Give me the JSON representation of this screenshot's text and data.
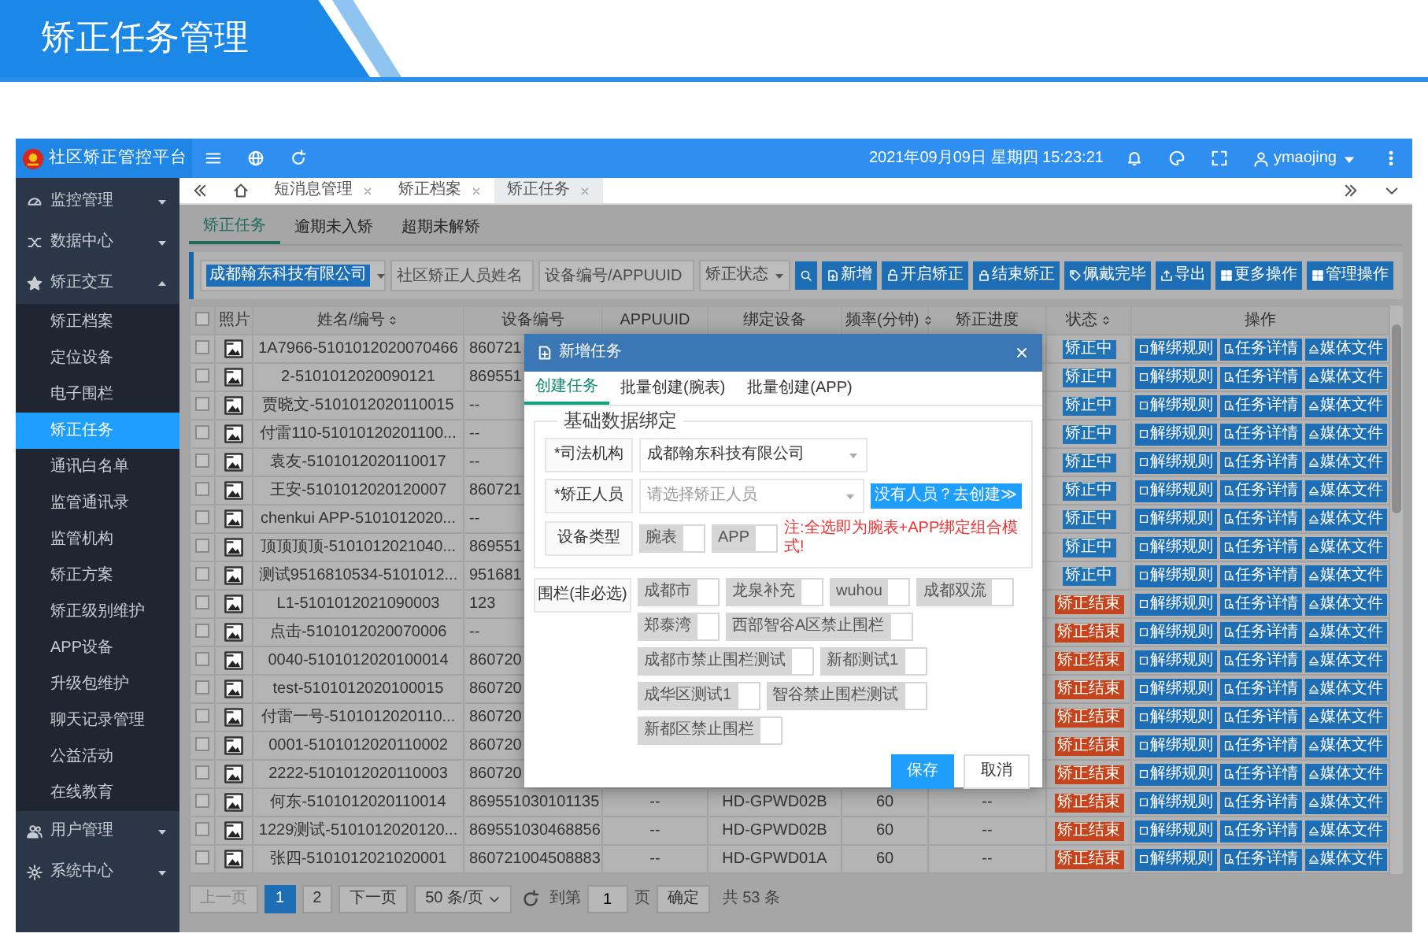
{
  "banner": {
    "title": "矫正任务管理"
  },
  "app": {
    "name": "社区矫正管控平台"
  },
  "header": {
    "datetime": "2021年09月09日 星期四 15:23:21",
    "user": "ymaojing"
  },
  "sidebar": {
    "items": [
      {
        "label": "监控管理",
        "expanded": false
      },
      {
        "label": "数据中心",
        "expanded": false
      },
      {
        "label": "矫正交互",
        "expanded": true,
        "children": [
          {
            "label": "矫正档案",
            "selected": false
          },
          {
            "label": "定位设备",
            "selected": false
          },
          {
            "label": "电子围栏",
            "selected": false
          },
          {
            "label": "矫正任务",
            "selected": true
          },
          {
            "label": "通讯白名单",
            "selected": false
          },
          {
            "label": "监管通讯录",
            "selected": false
          },
          {
            "label": "监管机构",
            "selected": false
          },
          {
            "label": "矫正方案",
            "selected": false
          },
          {
            "label": "矫正级别维护",
            "selected": false
          },
          {
            "label": "APP设备",
            "selected": false
          },
          {
            "label": "升级包维护",
            "selected": false
          },
          {
            "label": "聊天记录管理",
            "selected": false
          },
          {
            "label": "公益活动",
            "selected": false
          },
          {
            "label": "在线教育",
            "selected": false
          }
        ]
      },
      {
        "label": "用户管理",
        "expanded": false
      },
      {
        "label": "系统中心",
        "expanded": false
      }
    ]
  },
  "page_tabs": [
    {
      "label": "短消息管理",
      "selected": false
    },
    {
      "label": "矫正档案",
      "selected": false
    },
    {
      "label": "矫正任务",
      "selected": true
    }
  ],
  "sub_tabs": [
    {
      "label": "矫正任务",
      "selected": true
    },
    {
      "label": "逾期未入矫",
      "selected": false
    },
    {
      "label": "超期未解矫",
      "selected": false
    }
  ],
  "filters": {
    "org": "成都翰东科技有限公司",
    "name_placeholder": "社区矫正人员姓名",
    "device_placeholder": "设备编号/APPUUID",
    "status_placeholder": "矫正状态"
  },
  "toolbar": [
    {
      "kind": "search"
    },
    {
      "kind": "add",
      "label": "新增"
    },
    {
      "kind": "start",
      "label": "开启矫正"
    },
    {
      "kind": "stop",
      "label": "结束矫正"
    },
    {
      "kind": "wear",
      "label": "佩戴完毕"
    },
    {
      "kind": "export",
      "label": "导出"
    },
    {
      "kind": "more",
      "label": "更多操作"
    },
    {
      "kind": "manage",
      "label": "管理操作"
    }
  ],
  "table": {
    "select_all": {
      "checked": false
    },
    "columns": [
      {
        "label": "照片",
        "sortable": false
      },
      {
        "label": "姓名/编号",
        "sortable": true
      },
      {
        "label": "设备编号",
        "sortable": false
      },
      {
        "label": "APPUUID",
        "sortable": false
      },
      {
        "label": "绑定设备",
        "sortable": false
      },
      {
        "label": "频率(分钟)",
        "sortable": true
      },
      {
        "label": "矫正进度",
        "sortable": false
      },
      {
        "label": "状态",
        "sortable": true
      },
      {
        "label": "操作",
        "sortable": false
      }
    ],
    "rows": [
      {
        "checked": false,
        "name": "1A7966-5101012020070466",
        "device": "860721",
        "status": {
          "label": "矫正中",
          "color": "#2173b5"
        },
        "actions": [
          "解绑规则",
          "任务详情",
          "媒体文件"
        ]
      },
      {
        "checked": false,
        "name": "2-5101012020090121",
        "device": "869551",
        "status": {
          "label": "矫正中",
          "color": "#2173b5"
        },
        "actions": [
          "解绑规则",
          "任务详情",
          "媒体文件"
        ]
      },
      {
        "checked": false,
        "name": "贾晓文-5101012020110015",
        "device": "--",
        "status": {
          "label": "矫正中",
          "color": "#2173b5"
        },
        "actions": [
          "解绑规则",
          "任务详情",
          "媒体文件"
        ]
      },
      {
        "checked": false,
        "name": "付雷110-51010120201100...",
        "device": "--",
        "status": {
          "label": "矫正中",
          "color": "#2173b5"
        },
        "actions": [
          "解绑规则",
          "任务详情",
          "媒体文件"
        ]
      },
      {
        "checked": false,
        "name": "袁友-5101012020110017",
        "device": "--",
        "status": {
          "label": "矫正中",
          "color": "#2173b5"
        },
        "actions": [
          "解绑规则",
          "任务详情",
          "媒体文件"
        ]
      },
      {
        "checked": false,
        "name": "王安-5101012020120007",
        "device": "860721",
        "status": {
          "label": "矫正中",
          "color": "#2173b5"
        },
        "actions": [
          "解绑规则",
          "任务详情",
          "媒体文件"
        ]
      },
      {
        "checked": false,
        "name": "chenkui APP-5101012020...",
        "device": "--",
        "status": {
          "label": "矫正中",
          "color": "#2173b5"
        },
        "actions": [
          "解绑规则",
          "任务详情",
          "媒体文件"
        ]
      },
      {
        "checked": false,
        "name": "顶顶顶顶-5101012021040...",
        "device": "869551",
        "status": {
          "label": "矫正中",
          "color": "#2173b5"
        },
        "actions": [
          "解绑规则",
          "任务详情",
          "媒体文件"
        ]
      },
      {
        "checked": false,
        "name": "测试9516810534-5101012...",
        "device": "951681",
        "status": {
          "label": "矫正中",
          "color": "#2173b5"
        },
        "actions": [
          "解绑规则",
          "任务详情",
          "媒体文件"
        ]
      },
      {
        "checked": false,
        "name": "L1-5101012021090003",
        "device": "123",
        "status": {
          "label": "矫正结束",
          "color": "#c4441e"
        },
        "actions": [
          "解绑规则",
          "任务详情",
          "媒体文件"
        ]
      },
      {
        "checked": false,
        "name": "点击-5101012020070006",
        "device": "--",
        "status": {
          "label": "矫正结束",
          "color": "#c4441e"
        },
        "actions": [
          "解绑规则",
          "任务详情",
          "媒体文件"
        ]
      },
      {
        "checked": false,
        "name": "0040-5101012020100014",
        "device": "860720",
        "status": {
          "label": "矫正结束",
          "color": "#c4441e"
        },
        "actions": [
          "解绑规则",
          "任务详情",
          "媒体文件"
        ]
      },
      {
        "checked": false,
        "name": "test-5101012020100015",
        "device": "860720",
        "status": {
          "label": "矫正结束",
          "color": "#c4441e"
        },
        "actions": [
          "解绑规则",
          "任务详情",
          "媒体文件"
        ]
      },
      {
        "checked": false,
        "name": "付雷一号-5101012020110...",
        "device": "860720",
        "status": {
          "label": "矫正结束",
          "color": "#c4441e"
        },
        "actions": [
          "解绑规则",
          "任务详情",
          "媒体文件"
        ]
      },
      {
        "checked": false,
        "name": "0001-5101012020110002",
        "device": "860720",
        "status": {
          "label": "矫正结束",
          "color": "#c4441e"
        },
        "actions": [
          "解绑规则",
          "任务详情",
          "媒体文件"
        ]
      },
      {
        "checked": false,
        "name": "2222-5101012020110003",
        "device": "860720",
        "status": {
          "label": "矫正结束",
          "color": "#c4441e"
        },
        "actions": [
          "解绑规则",
          "任务详情",
          "媒体文件"
        ]
      },
      {
        "checked": false,
        "name": "何东-5101012020110014",
        "device": "869551030101135",
        "appuuid": "--",
        "bound_device": "HD-GPWD02B",
        "frequency": "60",
        "progress": "--",
        "status": {
          "label": "矫正结束",
          "color": "#c4441e"
        },
        "actions": [
          "解绑规则",
          "任务详情",
          "媒体文件"
        ]
      },
      {
        "checked": false,
        "name": "1229测试-5101012020120...",
        "device": "869551030468856",
        "appuuid": "--",
        "bound_device": "HD-GPWD02B",
        "frequency": "60",
        "progress": "--",
        "status": {
          "label": "矫正结束",
          "color": "#c4441e"
        },
        "actions": [
          "解绑规则",
          "任务详情",
          "媒体文件"
        ]
      },
      {
        "checked": false,
        "name": "张四-5101012021020001",
        "device": "860721004508883",
        "appuuid": "--",
        "bound_device": "HD-GPWD01A",
        "frequency": "60",
        "progress": "--",
        "status": {
          "label": "矫正结束",
          "color": "#c4441e"
        },
        "actions": [
          "解绑规则",
          "任务详情",
          "媒体文件"
        ]
      }
    ]
  },
  "pagination": {
    "prev": {
      "label": "上一页",
      "disabled": true
    },
    "pages": [
      {
        "label": "1",
        "selected": true
      },
      {
        "label": "2",
        "selected": false
      }
    ],
    "next": "下一页",
    "page_size": "50 条/页",
    "goto_label": "到第",
    "goto_value": "1",
    "page_unit": "页",
    "confirm": "确定",
    "total": "共 53 条"
  },
  "dialog": {
    "title": "新增任务",
    "tabs": [
      {
        "label": "创建任务",
        "selected": true
      },
      {
        "label": "批量创建(腕表)",
        "selected": false
      },
      {
        "label": "批量创建(APP)",
        "selected": false
      }
    ],
    "legend": "基础数据绑定",
    "fields": [
      {
        "kind": "select",
        "label": "*司法机构",
        "value": "成都翰东科技有限公司"
      },
      {
        "kind": "select",
        "label": "*矫正人员",
        "placeholder": "请选择矫正人员",
        "link": "没有人员？去创建≫"
      },
      {
        "kind": "checks",
        "label": "设备类型",
        "options": [
          {
            "label": "腕表",
            "checked": false
          },
          {
            "label": "APP",
            "checked": false
          }
        ],
        "note": "注:全选即为腕表+APP绑定组合模式!"
      }
    ],
    "fences": {
      "label": "围栏(非必选)",
      "options": [
        {
          "label": "成都市",
          "checked": false
        },
        {
          "label": "龙泉补充",
          "checked": false
        },
        {
          "label": "wuhou",
          "checked": false
        },
        {
          "label": "成都双流",
          "checked": false
        },
        {
          "label": "郑泰湾",
          "checked": false
        },
        {
          "label": "西部智谷A区禁止围栏",
          "checked": false
        },
        {
          "label": "成都市禁止围栏测试",
          "checked": false
        },
        {
          "label": "新都测试1",
          "checked": false
        },
        {
          "label": "成华区测试1",
          "checked": false
        },
        {
          "label": "智谷禁止围栏测试",
          "checked": false
        },
        {
          "label": "新都区禁止围栏",
          "checked": false
        }
      ]
    },
    "buttons": [
      {
        "kind": "primary",
        "label": "保存"
      },
      {
        "kind": "secondary",
        "label": "取消"
      }
    ]
  }
}
